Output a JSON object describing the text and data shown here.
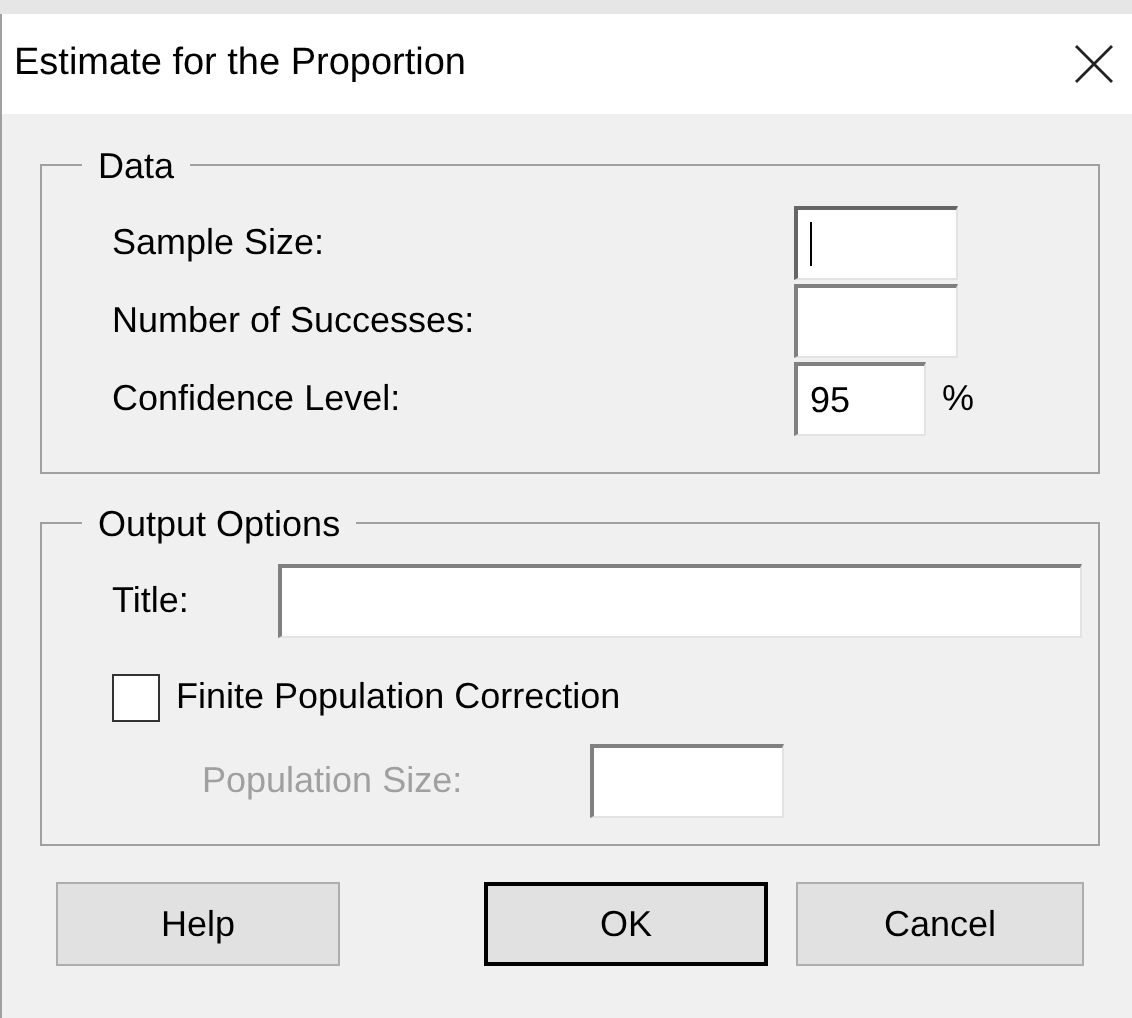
{
  "window": {
    "title": "Estimate for the Proportion"
  },
  "data_group": {
    "title": "Data",
    "fields": [
      {
        "label": "Sample Size:",
        "focused": true
      },
      {
        "label": "Number of Successes:",
        "focused": false
      },
      {
        "label": "Confidence Level:",
        "value": "95",
        "focused": false,
        "unit": "%"
      }
    ]
  },
  "output_group": {
    "title": "Output Options",
    "title_field": {
      "label": "Title:"
    },
    "checkbox": {
      "label": "Finite Population Correction",
      "checked": false
    },
    "population_size": {
      "label": "Population Size:",
      "disabled": true
    }
  },
  "buttons": [
    {
      "label": "Help",
      "default": false
    },
    {
      "label": "OK",
      "default": true
    },
    {
      "label": "Cancel",
      "default": false
    }
  ]
}
